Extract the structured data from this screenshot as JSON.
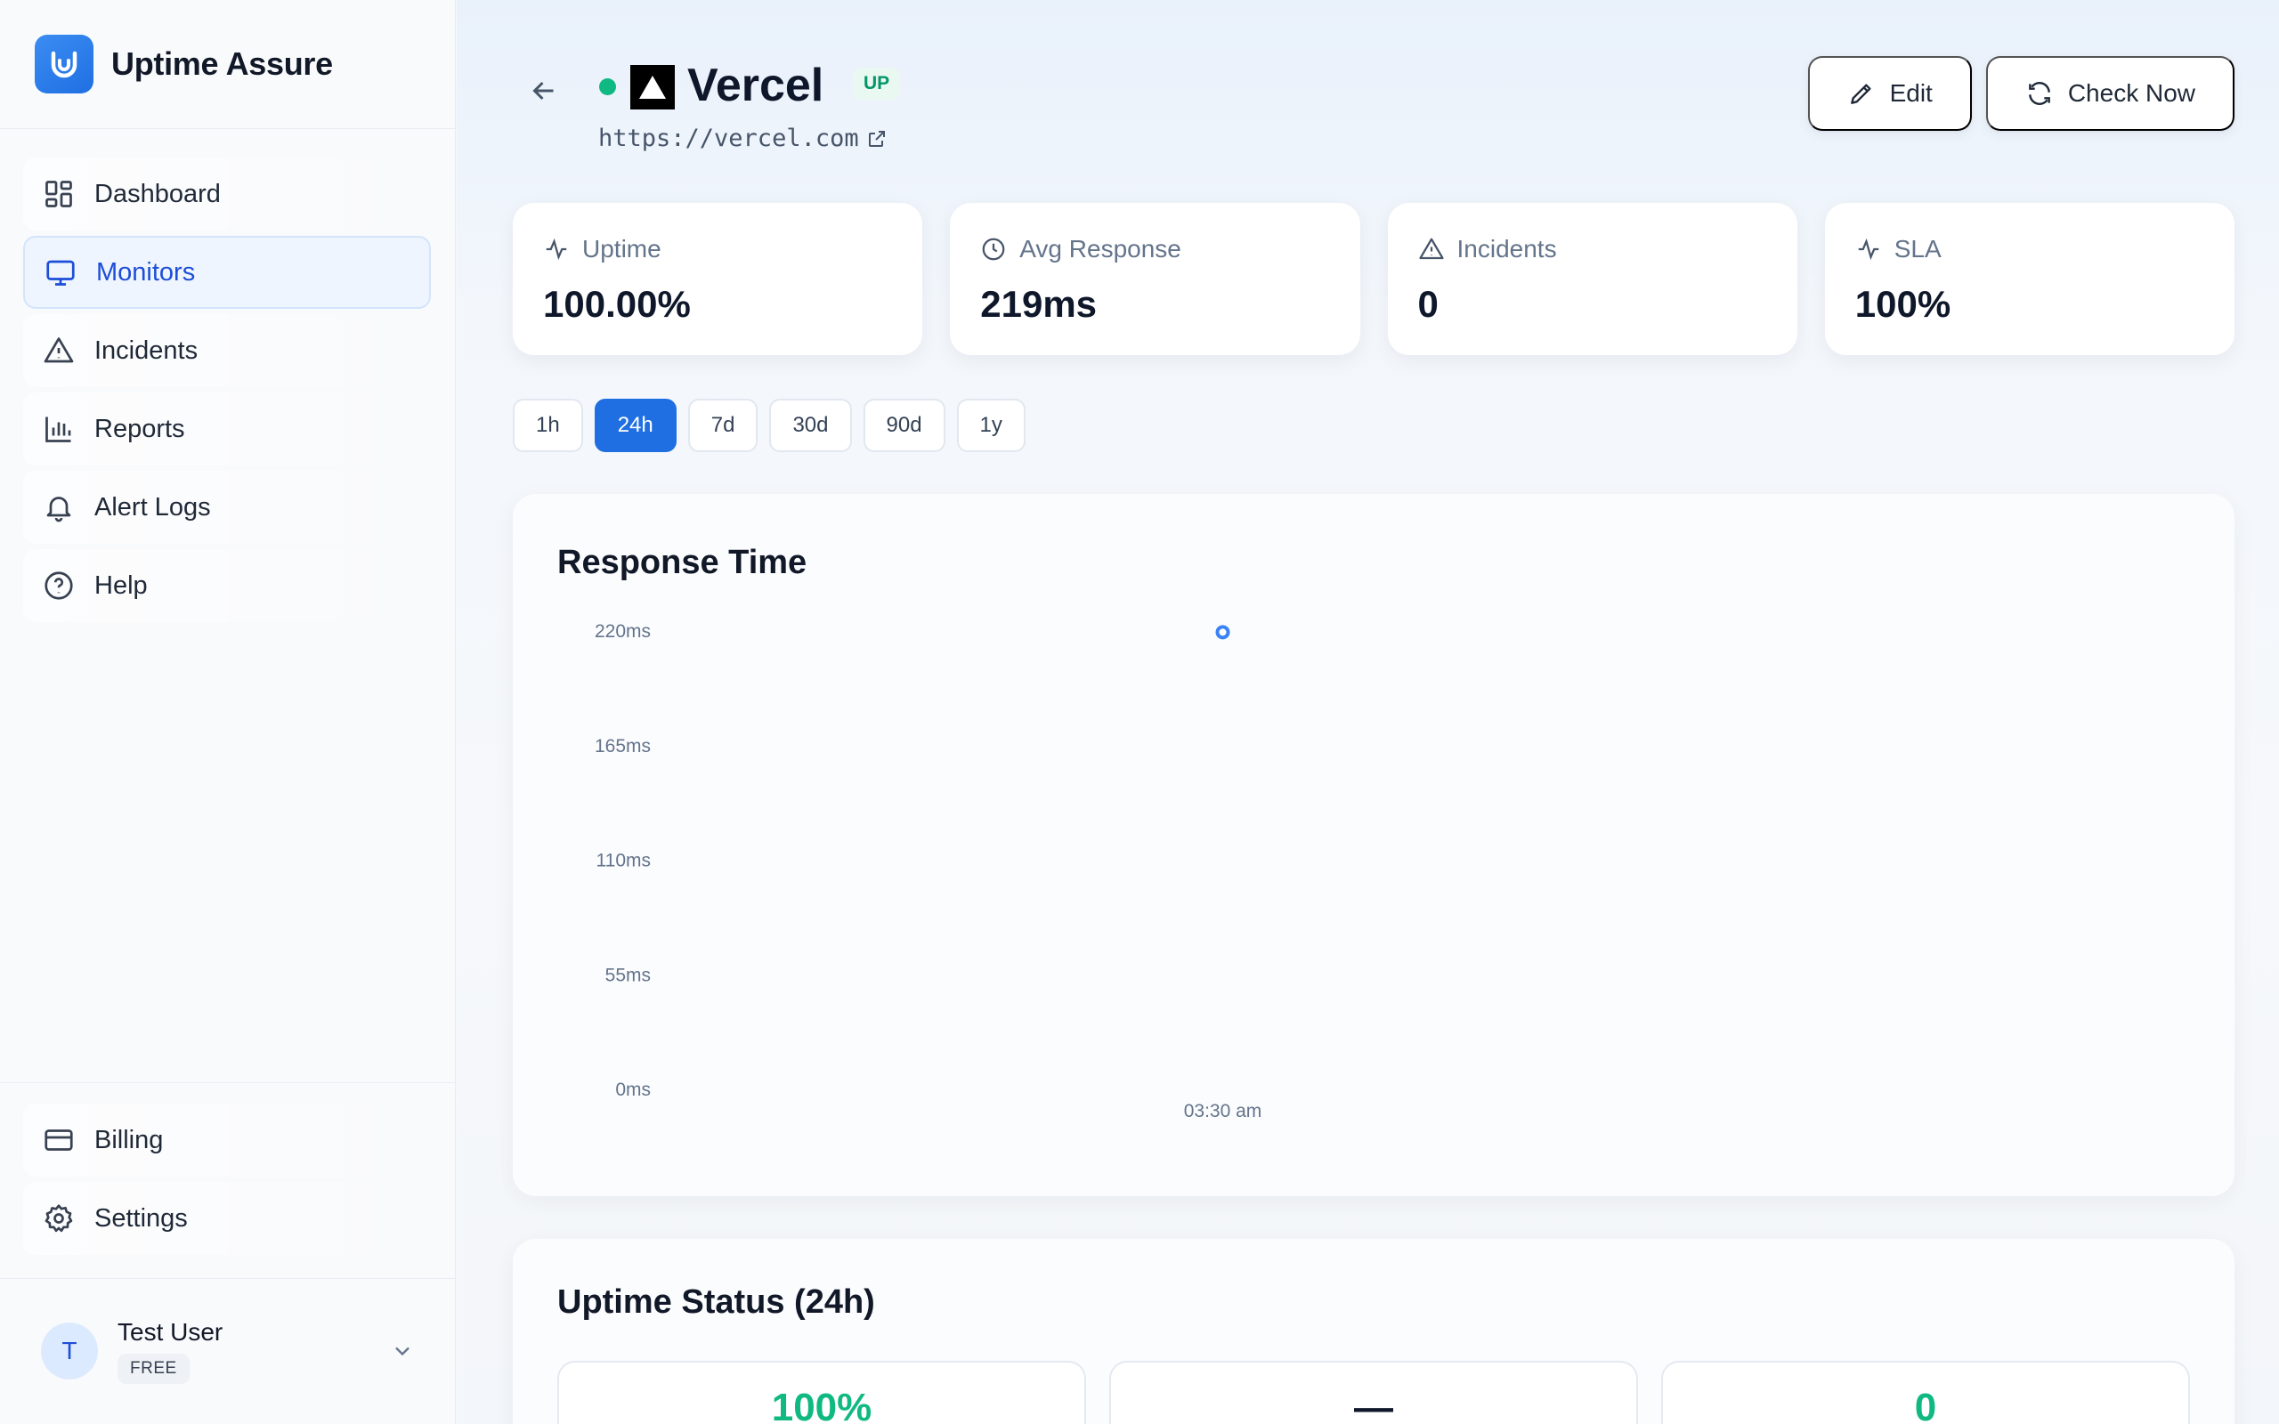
{
  "app": {
    "name": "Uptime Assure"
  },
  "sidebar": {
    "items": [
      {
        "label": "Dashboard",
        "icon": "dashboard-icon",
        "active": false
      },
      {
        "label": "Monitors",
        "icon": "monitor-icon",
        "active": true
      },
      {
        "label": "Incidents",
        "icon": "warning-icon",
        "active": false
      },
      {
        "label": "Reports",
        "icon": "bar-chart-icon",
        "active": false
      },
      {
        "label": "Alert Logs",
        "icon": "bell-icon",
        "active": false
      },
      {
        "label": "Help",
        "icon": "help-icon",
        "active": false
      }
    ],
    "bottom_items": [
      {
        "label": "Billing",
        "icon": "credit-card-icon"
      },
      {
        "label": "Settings",
        "icon": "gear-icon"
      }
    ],
    "user": {
      "initial": "T",
      "name": "Test User",
      "plan": "FREE"
    }
  },
  "monitor": {
    "name": "Vercel",
    "status": "UP",
    "url": "https://vercel.com",
    "status_color": "#10b981"
  },
  "actions": {
    "edit_label": "Edit",
    "check_label": "Check Now"
  },
  "stats": [
    {
      "label": "Uptime",
      "value": "100.00%",
      "icon": "activity-icon"
    },
    {
      "label": "Avg Response",
      "value": "219ms",
      "icon": "clock-icon"
    },
    {
      "label": "Incidents",
      "value": "0",
      "icon": "warning-icon"
    },
    {
      "label": "SLA",
      "value": "100%",
      "icon": "activity-icon"
    }
  ],
  "ranges": {
    "options": [
      "1h",
      "24h",
      "7d",
      "30d",
      "90d",
      "1y"
    ],
    "selected": "24h"
  },
  "response_chart": {
    "title": "Response Time"
  },
  "chart_data": {
    "type": "line",
    "title": "Response Time",
    "xlabel": "",
    "ylabel": "",
    "y_ticks": [
      "220ms",
      "165ms",
      "110ms",
      "55ms",
      "0ms"
    ],
    "ylim": [
      0,
      220
    ],
    "x": [
      "03:30 am"
    ],
    "series": [
      {
        "values": [
          219
        ]
      }
    ],
    "grid": false,
    "accent": "#3b82f6"
  },
  "uptime_status": {
    "title": "Uptime Status (24h)",
    "cards": [
      {
        "value": "100%",
        "color": "#10b981"
      },
      {
        "value": "—",
        "color": "#0f172a"
      },
      {
        "value": "0",
        "color": "#10b981"
      }
    ]
  },
  "colors": {
    "accent": "#1f6fe3",
    "success": "#10b981"
  }
}
